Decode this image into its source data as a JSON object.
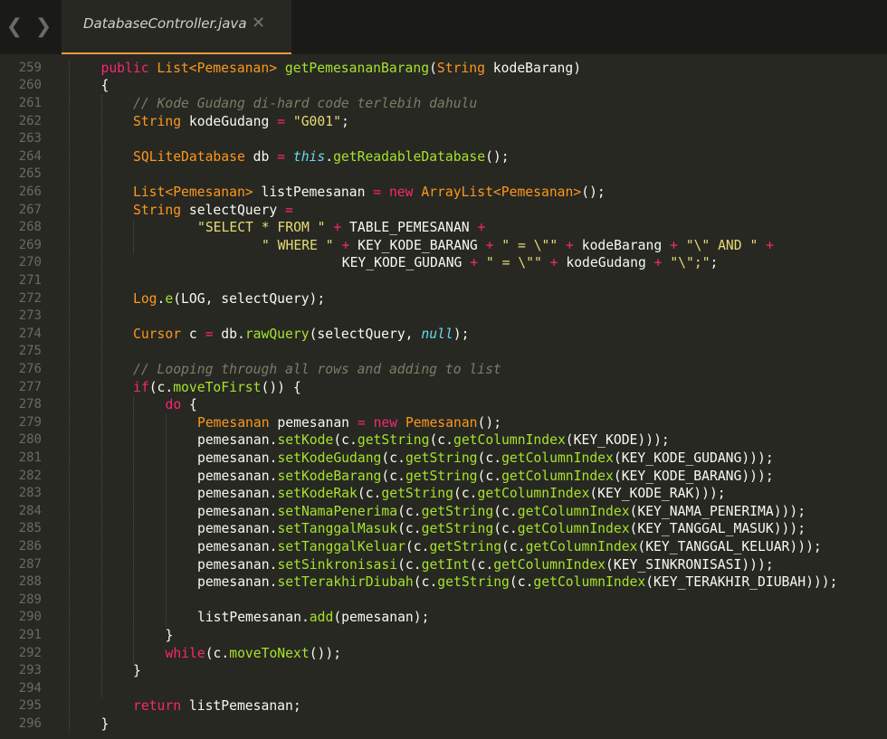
{
  "tabbar": {
    "back_icon": "chevron-left-icon",
    "forward_icon": "chevron-right-icon",
    "active_tab": {
      "title": "DatabaseController.java",
      "close_icon": "close-icon"
    },
    "accent_color": "#f09a3e"
  },
  "theme": {
    "background": "#272822",
    "keyword": "#f92672",
    "type": "#fd971f",
    "function": "#a6e22e",
    "string": "#e6db74",
    "comment": "#7e7b67",
    "builtin": "#66d9ef"
  },
  "editor": {
    "lines": [
      {
        "no": "259",
        "indent": 1,
        "tokens": [
          [
            "k",
            "public"
          ],
          [
            "d",
            " "
          ],
          [
            "t",
            "List<Pemesanan>"
          ],
          [
            "d",
            " "
          ],
          [
            "f",
            "getPemesananBarang"
          ],
          [
            "d",
            "("
          ],
          [
            "t",
            "String"
          ],
          [
            "d",
            " kodeBarang)"
          ]
        ]
      },
      {
        "no": "260",
        "indent": 1,
        "tokens": [
          [
            "d",
            "{"
          ]
        ]
      },
      {
        "no": "261",
        "indent": 2,
        "tokens": [
          [
            "c",
            "// Kode Gudang di-hard code terlebih dahulu"
          ]
        ]
      },
      {
        "no": "262",
        "indent": 2,
        "tokens": [
          [
            "t",
            "String"
          ],
          [
            "d",
            " kodeGudang "
          ],
          [
            "k",
            "="
          ],
          [
            "d",
            " "
          ],
          [
            "s",
            "\"G001\""
          ],
          [
            "d",
            ";"
          ]
        ]
      },
      {
        "no": "263",
        "indent": 2,
        "tokens": []
      },
      {
        "no": "264",
        "indent": 2,
        "tokens": [
          [
            "t",
            "SQLiteDatabase"
          ],
          [
            "d",
            " db "
          ],
          [
            "k",
            "="
          ],
          [
            "d",
            " "
          ],
          [
            "b",
            "this"
          ],
          [
            "d",
            "."
          ],
          [
            "f",
            "getReadableDatabase"
          ],
          [
            "d",
            "();"
          ]
        ]
      },
      {
        "no": "265",
        "indent": 2,
        "tokens": []
      },
      {
        "no": "266",
        "indent": 2,
        "tokens": [
          [
            "t",
            "List<Pemesanan>"
          ],
          [
            "d",
            " listPemesanan "
          ],
          [
            "k",
            "="
          ],
          [
            "d",
            " "
          ],
          [
            "k",
            "new"
          ],
          [
            "d",
            " "
          ],
          [
            "t",
            "ArrayList<Pemesanan>"
          ],
          [
            "d",
            "();"
          ]
        ]
      },
      {
        "no": "267",
        "indent": 2,
        "tokens": [
          [
            "t",
            "String"
          ],
          [
            "d",
            " selectQuery "
          ],
          [
            "k",
            "="
          ]
        ]
      },
      {
        "no": "268",
        "indent": 4,
        "tokens": [
          [
            "s",
            "\"SELECT * FROM \""
          ],
          [
            "d",
            " "
          ],
          [
            "k",
            "+"
          ],
          [
            "d",
            " TABLE_PEMESANAN "
          ],
          [
            "k",
            "+"
          ]
        ]
      },
      {
        "no": "269",
        "indent": 6,
        "tokens": [
          [
            "s",
            "\" WHERE \""
          ],
          [
            "d",
            " "
          ],
          [
            "k",
            "+"
          ],
          [
            "d",
            " KEY_KODE_BARANG "
          ],
          [
            "k",
            "+"
          ],
          [
            "d",
            " "
          ],
          [
            "s",
            "\" = \\\"\""
          ],
          [
            "d",
            " "
          ],
          [
            "k",
            "+"
          ],
          [
            "d",
            " kodeBarang "
          ],
          [
            "k",
            "+"
          ],
          [
            "d",
            " "
          ],
          [
            "s",
            "\"\\\" AND \""
          ],
          [
            "d",
            " "
          ],
          [
            "k",
            "+"
          ]
        ]
      },
      {
        "no": "270",
        "indent": 8,
        "pad": 2,
        "tokens": [
          [
            "d",
            "KEY_KODE_GUDANG "
          ],
          [
            "k",
            "+"
          ],
          [
            "d",
            " "
          ],
          [
            "s",
            "\" = \\\"\""
          ],
          [
            "d",
            " "
          ],
          [
            "k",
            "+"
          ],
          [
            "d",
            " kodeGudang "
          ],
          [
            "k",
            "+"
          ],
          [
            "d",
            " "
          ],
          [
            "s",
            "\"\\\";\""
          ],
          [
            "d",
            ";"
          ]
        ]
      },
      {
        "no": "271",
        "indent": 2,
        "tokens": []
      },
      {
        "no": "272",
        "indent": 2,
        "tokens": [
          [
            "t",
            "Log"
          ],
          [
            "d",
            "."
          ],
          [
            "f",
            "e"
          ],
          [
            "d",
            "(LOG, selectQuery);"
          ]
        ]
      },
      {
        "no": "273",
        "indent": 2,
        "tokens": []
      },
      {
        "no": "274",
        "indent": 2,
        "tokens": [
          [
            "t",
            "Cursor"
          ],
          [
            "d",
            " c "
          ],
          [
            "k",
            "="
          ],
          [
            "d",
            " db."
          ],
          [
            "f",
            "rawQuery"
          ],
          [
            "d",
            "(selectQuery, "
          ],
          [
            "b",
            "null"
          ],
          [
            "d",
            ");"
          ]
        ]
      },
      {
        "no": "275",
        "indent": 2,
        "tokens": []
      },
      {
        "no": "276",
        "indent": 2,
        "tokens": [
          [
            "c",
            "// Looping through all rows and adding to list"
          ]
        ]
      },
      {
        "no": "277",
        "indent": 2,
        "tokens": [
          [
            "k",
            "if"
          ],
          [
            "d",
            "(c."
          ],
          [
            "f",
            "moveToFirst"
          ],
          [
            "d",
            "()) {"
          ]
        ]
      },
      {
        "no": "278",
        "indent": 3,
        "tokens": [
          [
            "k",
            "do"
          ],
          [
            "d",
            " {"
          ]
        ]
      },
      {
        "no": "279",
        "indent": 4,
        "tokens": [
          [
            "t",
            "Pemesanan"
          ],
          [
            "d",
            " pemesanan "
          ],
          [
            "k",
            "="
          ],
          [
            "d",
            " "
          ],
          [
            "k",
            "new"
          ],
          [
            "d",
            " "
          ],
          [
            "t",
            "Pemesanan"
          ],
          [
            "d",
            "();"
          ]
        ]
      },
      {
        "no": "280",
        "indent": 4,
        "tokens": [
          [
            "d",
            "pemesanan."
          ],
          [
            "f",
            "setKode"
          ],
          [
            "d",
            "(c."
          ],
          [
            "f",
            "getString"
          ],
          [
            "d",
            "(c."
          ],
          [
            "f",
            "getColumnIndex"
          ],
          [
            "d",
            "(KEY_KODE)));"
          ]
        ]
      },
      {
        "no": "281",
        "indent": 4,
        "tokens": [
          [
            "d",
            "pemesanan."
          ],
          [
            "f",
            "setKodeGudang"
          ],
          [
            "d",
            "(c."
          ],
          [
            "f",
            "getString"
          ],
          [
            "d",
            "(c."
          ],
          [
            "f",
            "getColumnIndex"
          ],
          [
            "d",
            "(KEY_KODE_GUDANG)));"
          ]
        ]
      },
      {
        "no": "282",
        "indent": 4,
        "tokens": [
          [
            "d",
            "pemesanan."
          ],
          [
            "f",
            "setKodeBarang"
          ],
          [
            "d",
            "(c."
          ],
          [
            "f",
            "getString"
          ],
          [
            "d",
            "(c."
          ],
          [
            "f",
            "getColumnIndex"
          ],
          [
            "d",
            "(KEY_KODE_BARANG)));"
          ]
        ]
      },
      {
        "no": "283",
        "indent": 4,
        "tokens": [
          [
            "d",
            "pemesanan."
          ],
          [
            "f",
            "setKodeRak"
          ],
          [
            "d",
            "(c."
          ],
          [
            "f",
            "getString"
          ],
          [
            "d",
            "(c."
          ],
          [
            "f",
            "getColumnIndex"
          ],
          [
            "d",
            "(KEY_KODE_RAK)));"
          ]
        ]
      },
      {
        "no": "284",
        "indent": 4,
        "tokens": [
          [
            "d",
            "pemesanan."
          ],
          [
            "f",
            "setNamaPenerima"
          ],
          [
            "d",
            "(c."
          ],
          [
            "f",
            "getString"
          ],
          [
            "d",
            "(c."
          ],
          [
            "f",
            "getColumnIndex"
          ],
          [
            "d",
            "(KEY_NAMA_PENERIMA)));"
          ]
        ]
      },
      {
        "no": "285",
        "indent": 4,
        "tokens": [
          [
            "d",
            "pemesanan."
          ],
          [
            "f",
            "setTanggalMasuk"
          ],
          [
            "d",
            "(c."
          ],
          [
            "f",
            "getString"
          ],
          [
            "d",
            "(c."
          ],
          [
            "f",
            "getColumnIndex"
          ],
          [
            "d",
            "(KEY_TANGGAL_MASUK)));"
          ]
        ]
      },
      {
        "no": "286",
        "indent": 4,
        "tokens": [
          [
            "d",
            "pemesanan."
          ],
          [
            "f",
            "setTanggalKeluar"
          ],
          [
            "d",
            "(c."
          ],
          [
            "f",
            "getString"
          ],
          [
            "d",
            "(c."
          ],
          [
            "f",
            "getColumnIndex"
          ],
          [
            "d",
            "(KEY_TANGGAL_KELUAR)));"
          ]
        ]
      },
      {
        "no": "287",
        "indent": 4,
        "tokens": [
          [
            "d",
            "pemesanan."
          ],
          [
            "f",
            "setSinkronisasi"
          ],
          [
            "d",
            "(c."
          ],
          [
            "f",
            "getInt"
          ],
          [
            "d",
            "(c."
          ],
          [
            "f",
            "getColumnIndex"
          ],
          [
            "d",
            "(KEY_SINKRONISASI)));"
          ]
        ]
      },
      {
        "no": "288",
        "indent": 4,
        "tokens": [
          [
            "d",
            "pemesanan."
          ],
          [
            "f",
            "setTerakhirDiubah"
          ],
          [
            "d",
            "(c."
          ],
          [
            "f",
            "getString"
          ],
          [
            "d",
            "(c."
          ],
          [
            "f",
            "getColumnIndex"
          ],
          [
            "d",
            "(KEY_TERAKHIR_DIUBAH)));"
          ]
        ]
      },
      {
        "no": "289",
        "indent": 4,
        "tokens": []
      },
      {
        "no": "290",
        "indent": 4,
        "tokens": [
          [
            "d",
            "listPemesanan."
          ],
          [
            "f",
            "add"
          ],
          [
            "d",
            "(pemesanan);"
          ]
        ]
      },
      {
        "no": "291",
        "indent": 3,
        "tokens": [
          [
            "d",
            "}"
          ]
        ]
      },
      {
        "no": "292",
        "indent": 3,
        "tokens": [
          [
            "k",
            "while"
          ],
          [
            "d",
            "(c."
          ],
          [
            "f",
            "moveToNext"
          ],
          [
            "d",
            "());"
          ]
        ]
      },
      {
        "no": "293",
        "indent": 2,
        "tokens": [
          [
            "d",
            "}"
          ]
        ]
      },
      {
        "no": "294",
        "indent": 2,
        "tokens": []
      },
      {
        "no": "295",
        "indent": 2,
        "tokens": [
          [
            "k",
            "return"
          ],
          [
            "d",
            " listPemesanan;"
          ]
        ]
      },
      {
        "no": "296",
        "indent": 1,
        "tokens": [
          [
            "d",
            "}"
          ]
        ]
      }
    ]
  }
}
